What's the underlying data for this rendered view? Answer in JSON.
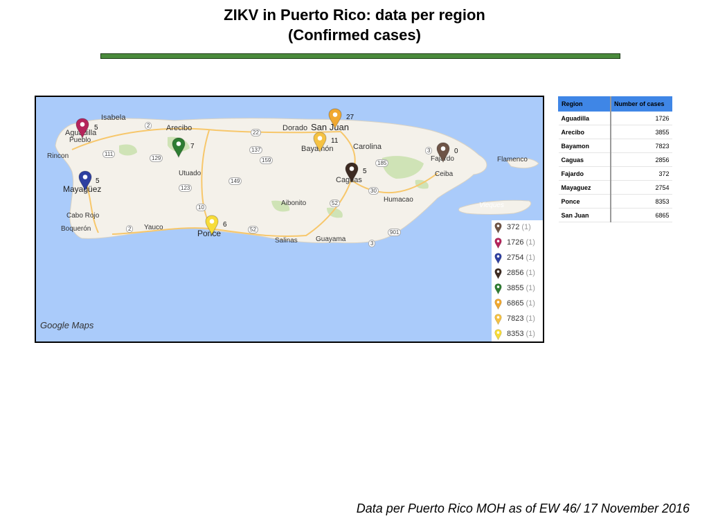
{
  "title_line1": "ZIKV in Puerto Rico: data per region",
  "title_line2": "(Confirmed cases)",
  "colors": {
    "rule": "#4a8a3c",
    "water": "#aacbfa",
    "land": "#f4f1ea",
    "table_header": "#3f86e6"
  },
  "map": {
    "attribution": "Google Maps",
    "places": [
      "Isabela",
      "Aguadilla",
      "Pueblo",
      "Arecibo",
      "Dorado",
      "San Juan",
      "Bayamón",
      "Carolina",
      "Fajardo",
      "Flamenco",
      "Rincon",
      "Utuado",
      "Mayagüez",
      "Caguas",
      "Ceiba",
      "Aibonito",
      "Humacao",
      "Cabo Rojo",
      "Vieques",
      "Boquerón",
      "Yauco",
      "Ponce",
      "Salinas",
      "Guayama"
    ],
    "routes": [
      "2",
      "22",
      "137",
      "159",
      "149",
      "10",
      "52",
      "123",
      "129",
      "111",
      "30",
      "185",
      "3",
      "901",
      "2",
      "52",
      "3"
    ],
    "pins": [
      {
        "region": "Aguadilla",
        "cases_label": "5",
        "color": "#b5245b"
      },
      {
        "region": "Arecibo",
        "cases_label": "7",
        "color": "#2e7d32"
      },
      {
        "region": "Mayaguez",
        "cases_label": "5",
        "color": "#2e3fa0"
      },
      {
        "region": "San Juan",
        "cases_label": "27",
        "color": "#f0a830"
      },
      {
        "region": "Bayamon",
        "cases_label": "11",
        "color": "#f5c243"
      },
      {
        "region": "Caguas",
        "cases_label": "5",
        "color": "#3d2b22"
      },
      {
        "region": "Fajardo",
        "cases_label": "0",
        "color": "#6e5446"
      },
      {
        "region": "Ponce",
        "cases_label": "6",
        "color": "#f7dc3a"
      }
    ],
    "legend": [
      {
        "value": "372",
        "count": "(1)",
        "color": "#6e5446"
      },
      {
        "value": "1726",
        "count": "(1)",
        "color": "#b5245b"
      },
      {
        "value": "2754",
        "count": "(1)",
        "color": "#2e3fa0"
      },
      {
        "value": "2856",
        "count": "(1)",
        "color": "#3d2b22"
      },
      {
        "value": "3855",
        "count": "(1)",
        "color": "#2e7d32"
      },
      {
        "value": "6865",
        "count": "(1)",
        "color": "#f0a830"
      },
      {
        "value": "7823",
        "count": "(1)",
        "color": "#f5c243"
      },
      {
        "value": "8353",
        "count": "(1)",
        "color": "#f7dc3a"
      }
    ]
  },
  "table": {
    "headers": [
      "Region",
      "Number of cases"
    ],
    "rows": [
      [
        "Aguadilla",
        "1726"
      ],
      [
        "Arecibo",
        "3855"
      ],
      [
        "Bayamon",
        "7823"
      ],
      [
        "Caguas",
        "2856"
      ],
      [
        "Fajardo",
        "372"
      ],
      [
        "Mayaguez",
        "2754"
      ],
      [
        "Ponce",
        "8353"
      ],
      [
        "San Juan",
        "6865"
      ]
    ]
  },
  "footer": "Data per Puerto Rico MOH as of EW 46/ 17 November 2016"
}
